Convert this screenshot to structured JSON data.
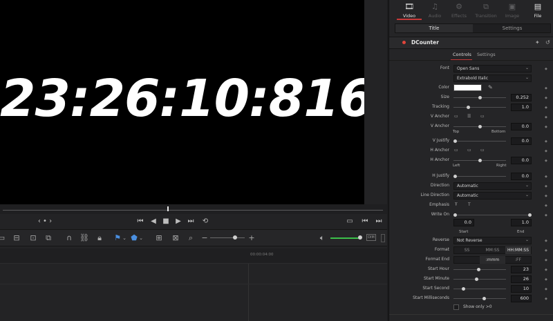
{
  "viewer": {
    "timecode": "23:26:10:816"
  },
  "page_tabs": [
    {
      "label": "Video",
      "icon": "film-icon"
    },
    {
      "label": "Audio",
      "icon": "music-note-icon"
    },
    {
      "label": "Effects",
      "icon": "effects-icon"
    },
    {
      "label": "Transition",
      "icon": "transition-icon"
    },
    {
      "label": "Image",
      "icon": "image-icon"
    },
    {
      "label": "File",
      "icon": "file-icon"
    }
  ],
  "subtabs": {
    "title": "Title",
    "settings": "Settings"
  },
  "effect": {
    "name": "DCounter",
    "status_color": "#e0453b",
    "accent_color": "#c83a3a"
  },
  "control_tabs": {
    "controls": "Controls",
    "settings": "Settings"
  },
  "fields": {
    "font": {
      "label": "Font",
      "value": "Open Sans",
      "style": "Extrabold Italic"
    },
    "color": {
      "label": "Color",
      "value": "#ffffff"
    },
    "size": {
      "label": "Size",
      "value": "0.252"
    },
    "tracking": {
      "label": "Tracking",
      "value": "1.0"
    },
    "v_anchor_icons": {
      "label": "V Anchor"
    },
    "v_anchor": {
      "label": "V Anchor",
      "value": "0.0",
      "min_label": "Top",
      "max_label": "Bottom"
    },
    "v_justify": {
      "label": "V Justify",
      "value": "0.0"
    },
    "h_anchor_icons": {
      "label": "H Anchor"
    },
    "h_anchor": {
      "label": "H Anchor",
      "value": "0.0",
      "min_label": "Left",
      "max_label": "Right"
    },
    "h_justify": {
      "label": "H Justify",
      "value": "0.0"
    },
    "direction": {
      "label": "Direction",
      "value": "Automatic"
    },
    "line_direction": {
      "label": "Line Direction",
      "value": "Automatic"
    },
    "emphasis": {
      "label": "Emphasis"
    },
    "write_on": {
      "label": "Write On",
      "start_value": "0.0",
      "end_value": "1.0",
      "start_label": "Start",
      "end_label": "End"
    },
    "reverse": {
      "label": "Reverse",
      "value": "Not Reverse"
    },
    "format": {
      "label": "Format",
      "options": [
        "SS",
        "MM:SS",
        "HH:MM:SS"
      ],
      "selected": "HH:MM:SS"
    },
    "format_end": {
      "label": "Format End",
      "options": [
        ":mmm",
        ":FF"
      ]
    },
    "start_hour": {
      "label": "Start Hour",
      "value": "23"
    },
    "start_minute": {
      "label": "Start Minute",
      "value": "26"
    },
    "start_second": {
      "label": "Start Second",
      "value": "10"
    },
    "start_milliseconds": {
      "label": "Start Milliseconds",
      "value": "600"
    },
    "show_only": {
      "label": "Show only >0"
    }
  },
  "timeline": {
    "ruler_timecode": "00:00:04:00"
  }
}
